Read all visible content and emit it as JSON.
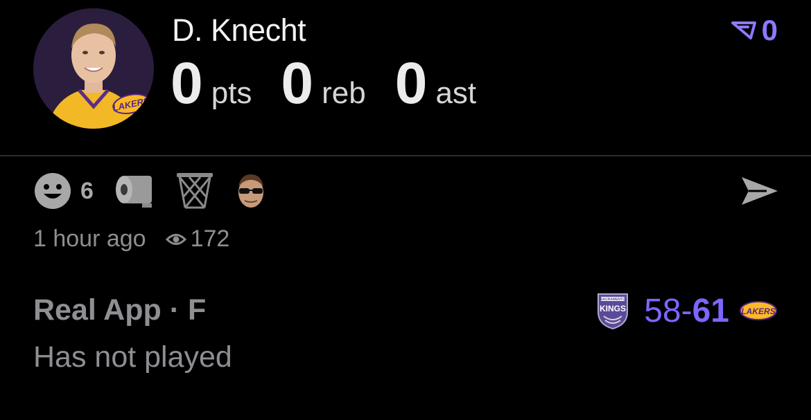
{
  "player": {
    "name": "D. Knecht",
    "team_badge": "LAKERS",
    "stats": [
      {
        "value": "0",
        "label": "pts"
      },
      {
        "value": "0",
        "label": "reb"
      },
      {
        "value": "0",
        "label": "ast"
      }
    ]
  },
  "coins": {
    "icon": "vote-arrow-icon",
    "count": "0",
    "color": "#8e78ff"
  },
  "reactions": [
    {
      "icon": "smiley-face-icon",
      "count": "6"
    },
    {
      "icon": "toilet-paper-icon"
    },
    {
      "icon": "basketball-net-icon"
    },
    {
      "icon": "sunglasses-face-icon"
    }
  ],
  "share": {
    "icon": "send-arrow-icon"
  },
  "meta": {
    "time_ago": "1 hour ago",
    "views_icon": "eye-icon",
    "views": "172"
  },
  "game": {
    "source": "Real App · F",
    "status": "Has not played",
    "away_team": {
      "name": "KINGS",
      "badge_line": "SACRAMENTO",
      "score": "58"
    },
    "separator": "-",
    "home_team": {
      "name": "LAKERS",
      "score": "61"
    },
    "score_color": "#7d66ff"
  },
  "colors": {
    "background": "#000000",
    "muted_text": "#8e8e93",
    "accent": "#7d66ff",
    "lakers_gold": "#fdb927",
    "lakers_purple": "#552583"
  }
}
